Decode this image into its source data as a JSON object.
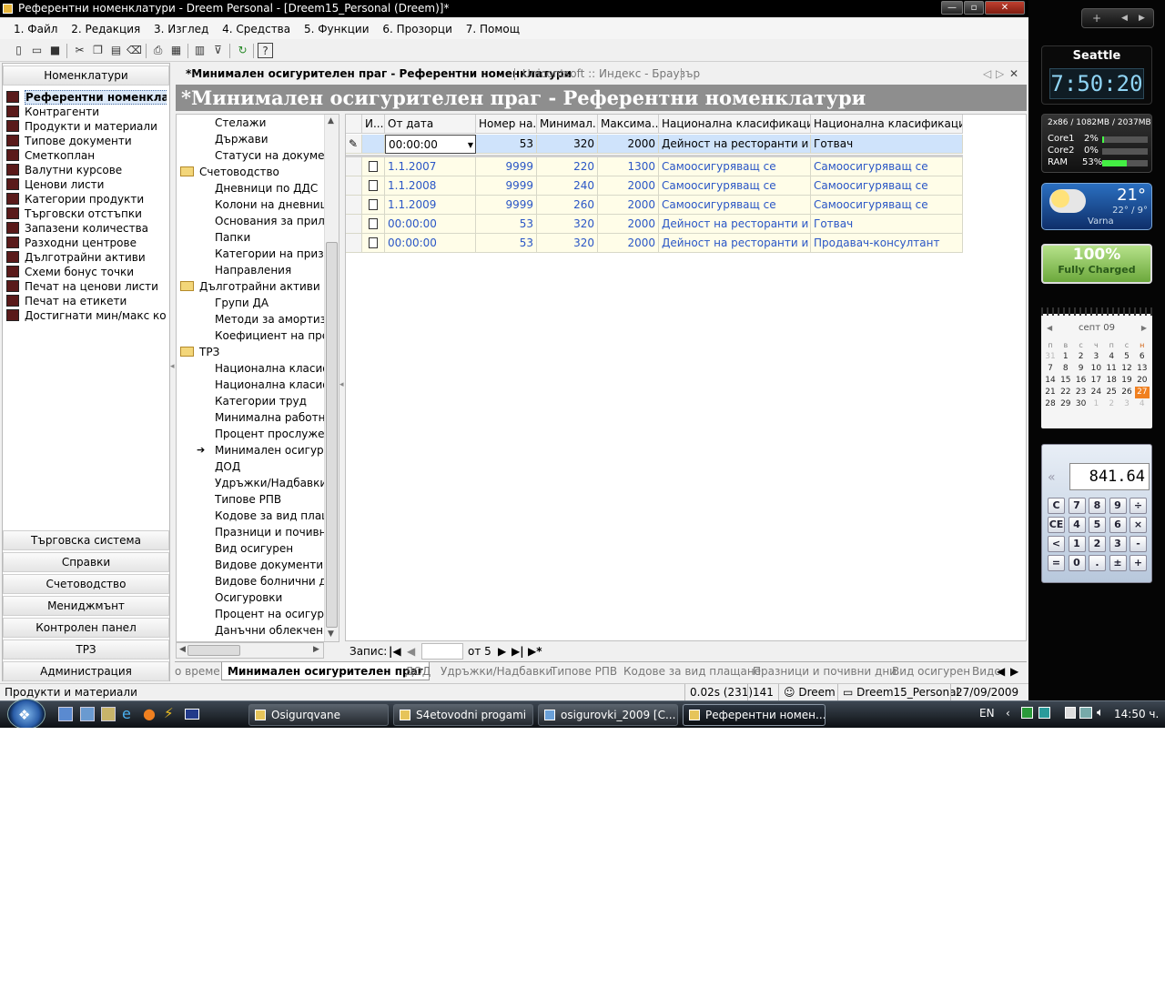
{
  "window": {
    "title": "Референтни номенклатури - Dreem Personal - [Dreem15_Personal (Dreem)]*",
    "min": "—",
    "max": "▫",
    "close": "✕"
  },
  "menu": [
    "1. Файл",
    "2. Редакция",
    "3. Изглед",
    "4. Средства",
    "5. Функции",
    "6. Прозорци",
    "7. Помощ"
  ],
  "leftnav": {
    "header": "Номенклатури",
    "items": [
      "Референтни номенклату...",
      "Контрагенти",
      "Продукти и материали",
      "Типове документи",
      "Сметкоплан",
      "Валутни курсове",
      "Ценови листи",
      "Категории продукти",
      "Търговски отстъпки",
      "Запазени количества",
      "Разходни центрове",
      "Дълготрайни активи",
      "Схеми бонус точки",
      "Печат на ценови листи",
      "Печат на етикети",
      "Достигнати мин/макс кол..."
    ],
    "sections": [
      "Търговска система",
      "Справки",
      "Счетоводство",
      "Мениджмънт",
      "Контролен панел",
      "ТРЗ",
      "Администрация"
    ]
  },
  "doctabs": {
    "active": "*Минимален осигурителен праг - Референтни номенклатури",
    "other": "Unicontsoft :: Индекс - Браузър",
    "nav_prev": "◁",
    "nav_next": "▷",
    "close": "✕"
  },
  "page_title": "*Минимален осигурителен праг - Референтни номенклатури",
  "tree": {
    "items": [
      {
        "label": "Стелажи",
        "level": 2
      },
      {
        "label": "Държави",
        "level": 2
      },
      {
        "label": "Статуси на документи",
        "level": 2
      },
      {
        "label": "Счетоводство",
        "level": 1
      },
      {
        "label": "Дневници по ДДС",
        "level": 2
      },
      {
        "label": "Колони на дневниците",
        "level": 2
      },
      {
        "label": "Основания за прилагане",
        "level": 2
      },
      {
        "label": "Папки",
        "level": 2
      },
      {
        "label": "Категории на признаци",
        "level": 2
      },
      {
        "label": "Направления",
        "level": 2
      },
      {
        "label": "Дълготрайни активи",
        "level": 1
      },
      {
        "label": "Групи ДА",
        "level": 2
      },
      {
        "label": "Методи за амортизация",
        "level": 2
      },
      {
        "label": "Коефициент на преоценка",
        "level": 2
      },
      {
        "label": "ТРЗ",
        "level": 1
      },
      {
        "label": "Национална класификация",
        "level": 2
      },
      {
        "label": "Национална класификация",
        "level": 2
      },
      {
        "label": "Категории труд",
        "level": 2
      },
      {
        "label": "Минимална работна заплата",
        "level": 2
      },
      {
        "label": "Процент прослужено време",
        "level": 2
      },
      {
        "label": "Минимален осигурителен праг",
        "level": 2,
        "selected": true
      },
      {
        "label": "ДОД",
        "level": 2
      },
      {
        "label": "Удръжки/Надбавки",
        "level": 2
      },
      {
        "label": "Типове РПВ",
        "level": 2
      },
      {
        "label": "Кодове за вид плащане",
        "level": 2
      },
      {
        "label": "Празници и почивни дни",
        "level": 2
      },
      {
        "label": "Вид осигурен",
        "level": 2
      },
      {
        "label": "Видове документи за самоосигуряващ се",
        "level": 2
      },
      {
        "label": "Видове болнични документи",
        "level": 2
      },
      {
        "label": "Осигуровки",
        "level": 2
      },
      {
        "label": "Процент на осигуровки",
        "level": 2
      },
      {
        "label": "Данъчни облекчения",
        "level": 2
      }
    ]
  },
  "grid": {
    "columns": [
      "И...",
      "От дата",
      "Номер на...",
      "Минимал...",
      "Максима...",
      "Национална класификация...",
      "Национална класификация..."
    ],
    "edit_row": [
      "00:00:00",
      "53",
      "320",
      "2000",
      "Дейност на ресторанти и за...",
      "Готвач"
    ],
    "rows": [
      [
        "1.1.2007",
        "9999",
        "220",
        "1300",
        "Самоосигуряващ се",
        "Самоосигуряващ се"
      ],
      [
        "1.1.2008",
        "9999",
        "240",
        "2000",
        "Самоосигуряващ се",
        "Самоосигуряващ се"
      ],
      [
        "1.1.2009",
        "9999",
        "260",
        "2000",
        "Самоосигуряващ се",
        "Самоосигуряващ се"
      ],
      [
        "00:00:00",
        "53",
        "320",
        "2000",
        "Дейност на ресторанти и за...",
        "Готвач"
      ],
      [
        "00:00:00",
        "53",
        "320",
        "2000",
        "Дейност на ресторанти и за...",
        "Продавач-консултант"
      ]
    ]
  },
  "navigator": {
    "label": "Запис:",
    "of": "от 5",
    "current": ""
  },
  "bottomtabs": [
    "о време",
    "Минимален осигурителен праг",
    "ДОД",
    "Удръжки/Надбавки",
    "Типове РПВ",
    "Кодове за вид плащане",
    "Празници и почивни дни",
    "Вид осигурен",
    "Видо"
  ],
  "status": {
    "text": "Продукти и материали",
    "timing": "0.02s (231)",
    "count": "141",
    "user": "Dreem",
    "db": "Dreem15_Personal",
    "date": "27/09/2009"
  },
  "taskbar": {
    "buttons": [
      "Osigurqvane",
      "S4etovodni progami",
      "osigurovki_2009  [C...",
      "Референтни номен..."
    ],
    "lang": "EN",
    "time": "14:50 ч."
  },
  "gadgets": {
    "clock_city": "Seattle",
    "clock_time": "7:50:20",
    "cpu": {
      "header": "2x86 / 1082MB / 2037MB",
      "core1_label": "Core1",
      "core1": "2%",
      "core2_label": "Core2",
      "core2": "0%",
      "ram_label": "RAM",
      "ram": "53%",
      "ram_level": 0.53
    },
    "weather": {
      "temp": "21°",
      "range": "22° / 9°",
      "city": "Varna"
    },
    "battery": {
      "percent": "100%",
      "status": "Fully Charged"
    },
    "calendar": {
      "month": "септ 09",
      "days": [
        "п",
        "в",
        "с",
        "ч",
        "п",
        "с",
        "н"
      ],
      "weeks": [
        [
          "31",
          "1",
          "2",
          "3",
          "4",
          "5",
          "6"
        ],
        [
          "7",
          "8",
          "9",
          "10",
          "11",
          "12",
          "13"
        ],
        [
          "14",
          "15",
          "16",
          "17",
          "18",
          "19",
          "20"
        ],
        [
          "21",
          "22",
          "23",
          "24",
          "25",
          "26",
          "27"
        ],
        [
          "28",
          "29",
          "30",
          "1",
          "2",
          "3",
          "4"
        ]
      ],
      "today": "27"
    },
    "calculator": {
      "display": "841.64",
      "keys": [
        [
          "C",
          "7",
          "8",
          "9",
          "÷"
        ],
        [
          "CE",
          "4",
          "5",
          "6",
          "×"
        ],
        [
          "<",
          "1",
          "2",
          "3",
          "-"
        ],
        [
          "=",
          "0",
          ".",
          "±",
          "+"
        ]
      ]
    }
  }
}
